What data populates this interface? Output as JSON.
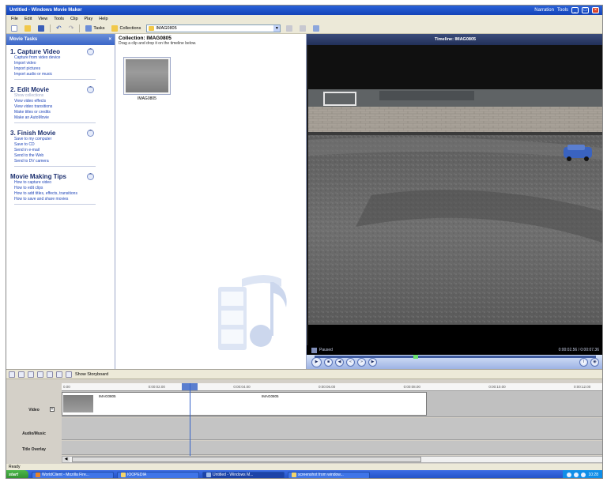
{
  "window": {
    "title": "Untitled - Windows Movie Maker",
    "right_tools": [
      "Narration",
      "Tools"
    ]
  },
  "menu": [
    "File",
    "Edit",
    "View",
    "Tools",
    "Clip",
    "Play",
    "Help"
  ],
  "toolbar": {
    "tasks_label": "Tasks",
    "collections_label": "Collections",
    "collection_value": "IMAG0805"
  },
  "tasks_pane": {
    "header": "Movie Tasks",
    "sections": [
      {
        "title": "1. Capture Video",
        "items": [
          {
            "label": "Capture from video device",
            "disabled": false
          },
          {
            "label": "Import video",
            "disabled": false
          },
          {
            "label": "Import pictures",
            "disabled": false
          },
          {
            "label": "Import audio or music",
            "disabled": false
          }
        ]
      },
      {
        "title": "2. Edit Movie",
        "items": [
          {
            "label": "Show collections",
            "disabled": true
          },
          {
            "label": "View video effects",
            "disabled": false
          },
          {
            "label": "View video transitions",
            "disabled": false
          },
          {
            "label": "Make titles or credits",
            "disabled": false
          },
          {
            "label": "Make an AutoMovie",
            "disabled": false
          }
        ]
      },
      {
        "title": "3. Finish Movie",
        "items": [
          {
            "label": "Save to my computer",
            "disabled": false
          },
          {
            "label": "Save to CD",
            "disabled": false
          },
          {
            "label": "Send in e-mail",
            "disabled": false
          },
          {
            "label": "Send to the Web",
            "disabled": false
          },
          {
            "label": "Send to DV camera",
            "disabled": false
          }
        ]
      },
      {
        "title": "Movie Making Tips",
        "items": [
          {
            "label": "How to capture video",
            "disabled": false
          },
          {
            "label": "How to edit clips",
            "disabled": false
          },
          {
            "label": "How to add titles, effects, transitions",
            "disabled": false
          },
          {
            "label": "How to save and share movies",
            "disabled": false
          }
        ]
      }
    ]
  },
  "collection": {
    "title": "Collection: IMAG0805",
    "hint": "Drag a clip and drop it on the timeline below.",
    "clip_label": "IMAG0805"
  },
  "monitor": {
    "title": "Timeline: IMAG0805",
    "status": "Paused",
    "time": "0:00:02.56 / 0:00:07.36",
    "seek_fraction": 0.35
  },
  "timeline": {
    "storyboard_label": "Show Storyboard",
    "ruler_ticks": [
      "0.00",
      "0:00:02.00",
      "0:00:04.00",
      "0:00:06.00",
      "0:00:08.00",
      "0:00:10.00",
      "0:00:12.00"
    ],
    "tracks": {
      "video": "Video",
      "audio": "Audio/Music",
      "overlay": "Title Overlay"
    },
    "clip_names": [
      "IMAG0805",
      "IMAG0805"
    ]
  },
  "status": "Ready",
  "taskbar": {
    "start": "start",
    "items": [
      {
        "label": "WorldClient - Mozilla Fire...",
        "color": "#E8842A",
        "active": false
      },
      {
        "label": "IOOPEDIA",
        "color": "#F3D46A",
        "active": false
      },
      {
        "label": "Untitled - Windows M...",
        "color": "#9CB8E8",
        "active": true
      },
      {
        "label": "screenshot from window...",
        "color": "#F3D46A",
        "active": false
      }
    ],
    "clock": "10:28"
  }
}
